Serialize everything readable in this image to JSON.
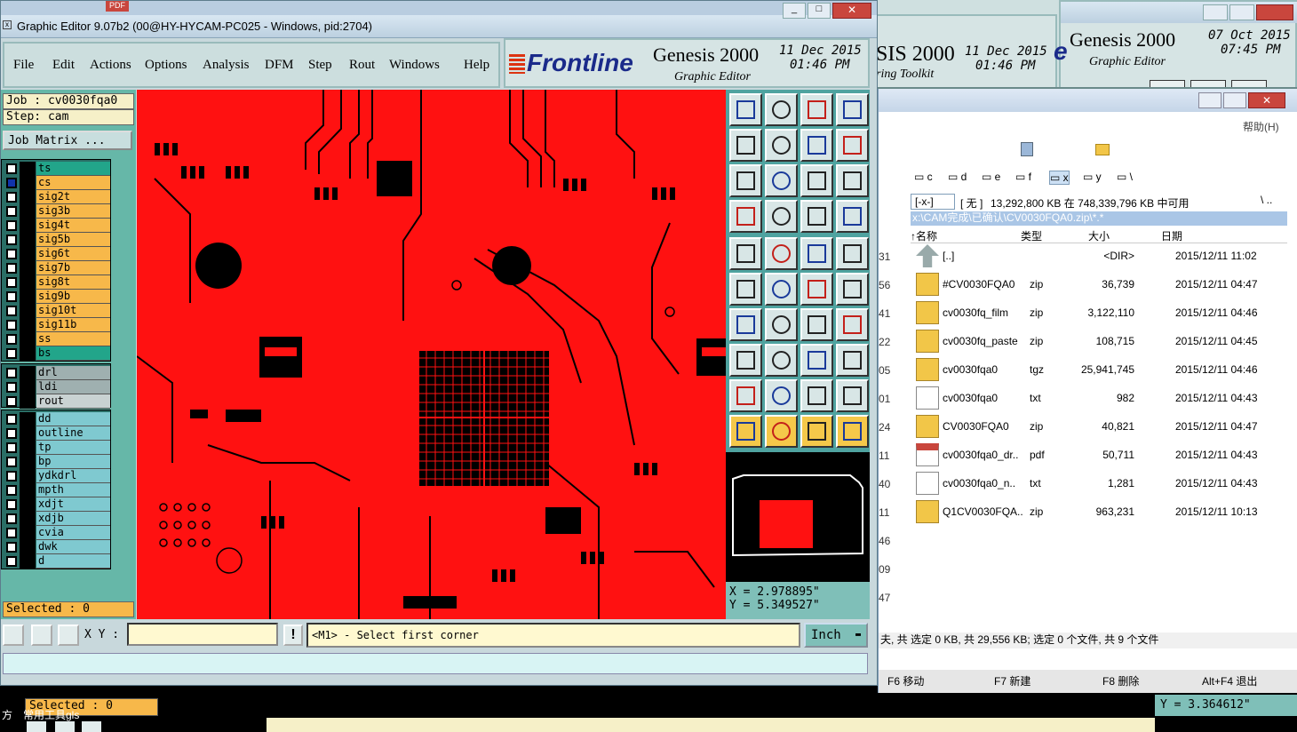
{
  "main_window": {
    "title": "Graphic Editor 9.07b2 (00@HY-HYCAM-PC025 - Windows, pid:2704)",
    "menu": [
      "File",
      "Edit",
      "Actions",
      "Options",
      "Analysis",
      "DFM",
      "Step",
      "Rout",
      "Windows",
      "Help"
    ],
    "banner": {
      "logo": "Frontline",
      "product": "Genesis 2000",
      "subtitle": "Graphic Editor",
      "date": "11 Dec 2015",
      "time": "01:46 PM"
    }
  },
  "background_windows": {
    "genesis2_product": "SIS 2000",
    "genesis2_date": "11 Dec 2015",
    "genesis2_time": "01:46 PM",
    "genesis2_subtitle": "ring Toolkit",
    "genesis3_product": "Genesis 2000",
    "genesis3_date": "07 Oct 2015",
    "genesis3_time": "07:45 PM",
    "genesis3_subtitle": "Graphic Editor"
  },
  "job": {
    "job_label": "Job : cv0030fqa0",
    "step_label": "Step: cam",
    "matrix_button": "Job Matrix ...",
    "selected_label": "Selected : 0"
  },
  "layers": {
    "board": [
      {
        "name": "ts",
        "color": "#22a58a"
      },
      {
        "name": "cs",
        "color": "#f7b84a"
      },
      {
        "name": "sig2t",
        "color": "#f7b84a"
      },
      {
        "name": "sig3b",
        "color": "#f7b84a"
      },
      {
        "name": "sig4t",
        "color": "#f7b84a"
      },
      {
        "name": "sig5b",
        "color": "#f7b84a"
      },
      {
        "name": "sig6t",
        "color": "#f7b84a"
      },
      {
        "name": "sig7b",
        "color": "#f7b84a"
      },
      {
        "name": "sig8t",
        "color": "#f7b84a"
      },
      {
        "name": "sig9b",
        "color": "#f7b84a"
      },
      {
        "name": "sig10t",
        "color": "#f7b84a"
      },
      {
        "name": "sig11b",
        "color": "#f7b84a"
      },
      {
        "name": "ss",
        "color": "#f7b84a"
      },
      {
        "name": "bs",
        "color": "#22a58a"
      }
    ],
    "drill": [
      {
        "name": "drl",
        "color": "#9fb0b0"
      },
      {
        "name": "ldi",
        "color": "#9fb0b0"
      },
      {
        "name": "rout",
        "color": "#c9d2d2"
      }
    ],
    "misc": [
      {
        "name": "dd",
        "color": "#7fc9d0"
      },
      {
        "name": "outline",
        "color": "#7fc9d0"
      },
      {
        "name": "tp",
        "color": "#7fc9d0"
      },
      {
        "name": "bp",
        "color": "#7fc9d0"
      },
      {
        "name": "ydkdrl",
        "color": "#7fc9d0"
      },
      {
        "name": "mpth",
        "color": "#7fc9d0"
      },
      {
        "name": "xdjt",
        "color": "#7fc9d0"
      },
      {
        "name": "xdjb",
        "color": "#7fc9d0"
      },
      {
        "name": "cvia",
        "color": "#7fc9d0"
      },
      {
        "name": "dwk",
        "color": "#7fc9d0"
      },
      {
        "name": "d",
        "color": "#7fc9d0"
      }
    ]
  },
  "coords": {
    "x": "X = 2.978895\"",
    "y": "Y = 5.349527\""
  },
  "status": {
    "xy_label": "X Y :",
    "xy_value": "",
    "message": "<M1> - Select first corner",
    "units": "Inch"
  },
  "bottom_ghost": {
    "selected": "Selected : 0",
    "chinese_label": "常用工具gls",
    "prefix": "方",
    "ghost_y": "Y = 3.364612\""
  },
  "file_manager": {
    "menu_help": "帮助(H)",
    "drives": [
      "c",
      "d",
      "e",
      "f",
      "x",
      "y",
      "\\"
    ],
    "drive_select": "[-x-]",
    "volume_label": "[ 无 ]",
    "free_space": "13,292,800 KB 在 748,339,796 KB 中可用",
    "path": "x:\\CAM完成\\已确认\\CV0030FQA0.zip\\*.*",
    "columns": [
      "↑名称",
      "类型",
      "大小",
      "日期"
    ],
    "files": [
      {
        "name": "[..]",
        "type": "",
        "size": "<DIR>",
        "date": "2015/12/11 11:02",
        "icon": "up-folder"
      },
      {
        "name": "#CV0030FQA0",
        "type": "zip",
        "size": "36,739",
        "date": "2015/12/11 04:47",
        "icon": "archive"
      },
      {
        "name": "cv0030fq_film",
        "type": "zip",
        "size": "3,122,110",
        "date": "2015/12/11 04:46",
        "icon": "archive"
      },
      {
        "name": "cv0030fq_paste",
        "type": "zip",
        "size": "108,715",
        "date": "2015/12/11 04:45",
        "icon": "archive"
      },
      {
        "name": "cv0030fqa0",
        "type": "tgz",
        "size": "25,941,745",
        "date": "2015/12/11 04:46",
        "icon": "archive"
      },
      {
        "name": "cv0030fqa0",
        "type": "txt",
        "size": "982",
        "date": "2015/12/11 04:43",
        "icon": "text"
      },
      {
        "name": "CV0030FQA0",
        "type": "zip",
        "size": "40,821",
        "date": "2015/12/11 04:47",
        "icon": "archive"
      },
      {
        "name": "cv0030fqa0_dr..",
        "type": "pdf",
        "size": "50,711",
        "date": "2015/12/11 04:43",
        "icon": "pdf"
      },
      {
        "name": "cv0030fqa0_n..",
        "type": "txt",
        "size": "1,281",
        "date": "2015/12/11 04:43",
        "icon": "text"
      },
      {
        "name": "Q1CV0030FQA..",
        "type": "zip",
        "size": "963,231",
        "date": "2015/12/11 10:13",
        "icon": "archive"
      }
    ],
    "left_numbers": [
      "31",
      "56",
      "41",
      "22",
      "05",
      "01",
      "24",
      "11",
      "40",
      "11",
      "46",
      "09",
      "47"
    ],
    "status": "夫, 共 选定 0 KB, 共 29,556 KB; 选定 0 个文件, 共 9 个文件",
    "fkeys": [
      "F6 移动",
      "F7 新建",
      "F8 删除",
      "Alt+F4 退出"
    ]
  }
}
